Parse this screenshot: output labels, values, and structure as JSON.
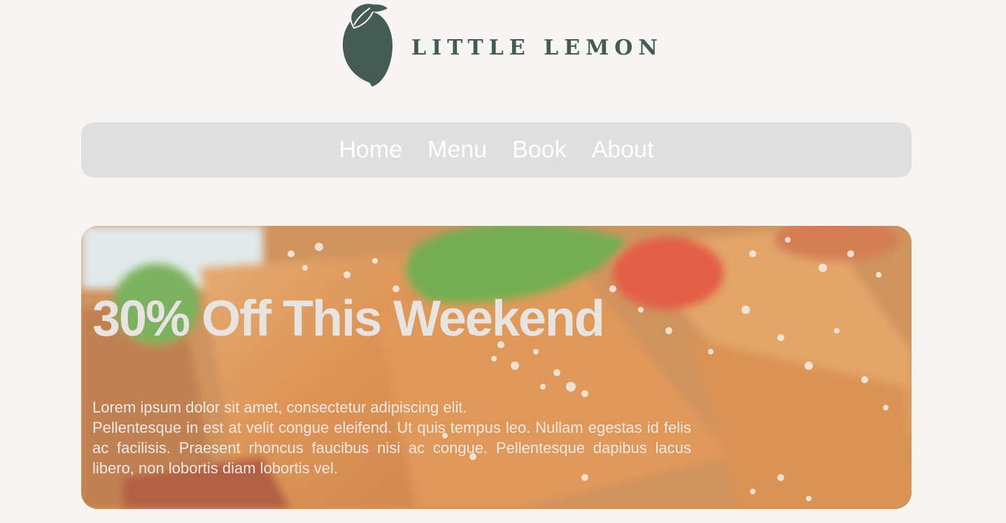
{
  "brand": {
    "name": "LITTLE LEMON",
    "logo_icon": "lemon-icon",
    "color": "#435b53"
  },
  "nav": {
    "items": [
      {
        "label": "Home"
      },
      {
        "label": "Menu"
      },
      {
        "label": "Book"
      },
      {
        "label": "About"
      }
    ]
  },
  "hero": {
    "image": "pasta-image",
    "title": "30% Off This Weekend",
    "lines": [
      "Lorem ipsum dolor sit amet, consectetur adipiscing elit.",
      "Pellentesque in est at velit congue eleifend. Ut quis tempus leo. Nullam egestas id felis ac facilisis. Praesent rhoncus faucibus nisi ac congue. Pellentesque dapibus lacus libero, non lobortis diam lobortis vel."
    ]
  }
}
